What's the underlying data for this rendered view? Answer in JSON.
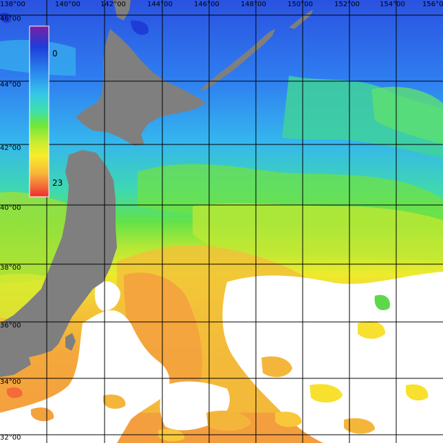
{
  "map": {
    "lon_labels": [
      "138°00",
      "140°00",
      "142°00",
      "144°00",
      "146°00",
      "148°00",
      "150°00",
      "152°00",
      "154°00",
      "156°0"
    ],
    "lat_labels": [
      "46°00",
      "44°00",
      "42°00",
      "40°00",
      "38°00",
      "36°00",
      "34°00",
      "32°00"
    ],
    "colorbar": {
      "min_label": "0",
      "max_label": "23",
      "colors": [
        "#7a1fa2",
        "#1e3cd8",
        "#2c8cf0",
        "#35c8e8",
        "#3fe0a8",
        "#70e63a",
        "#c8ec30",
        "#f8ec28",
        "#f8b83a",
        "#f46a3a",
        "#f02a2a"
      ]
    },
    "land_color": "#7f7f7f",
    "no_data_color": "#ffffff",
    "grid_color": "#000000"
  }
}
